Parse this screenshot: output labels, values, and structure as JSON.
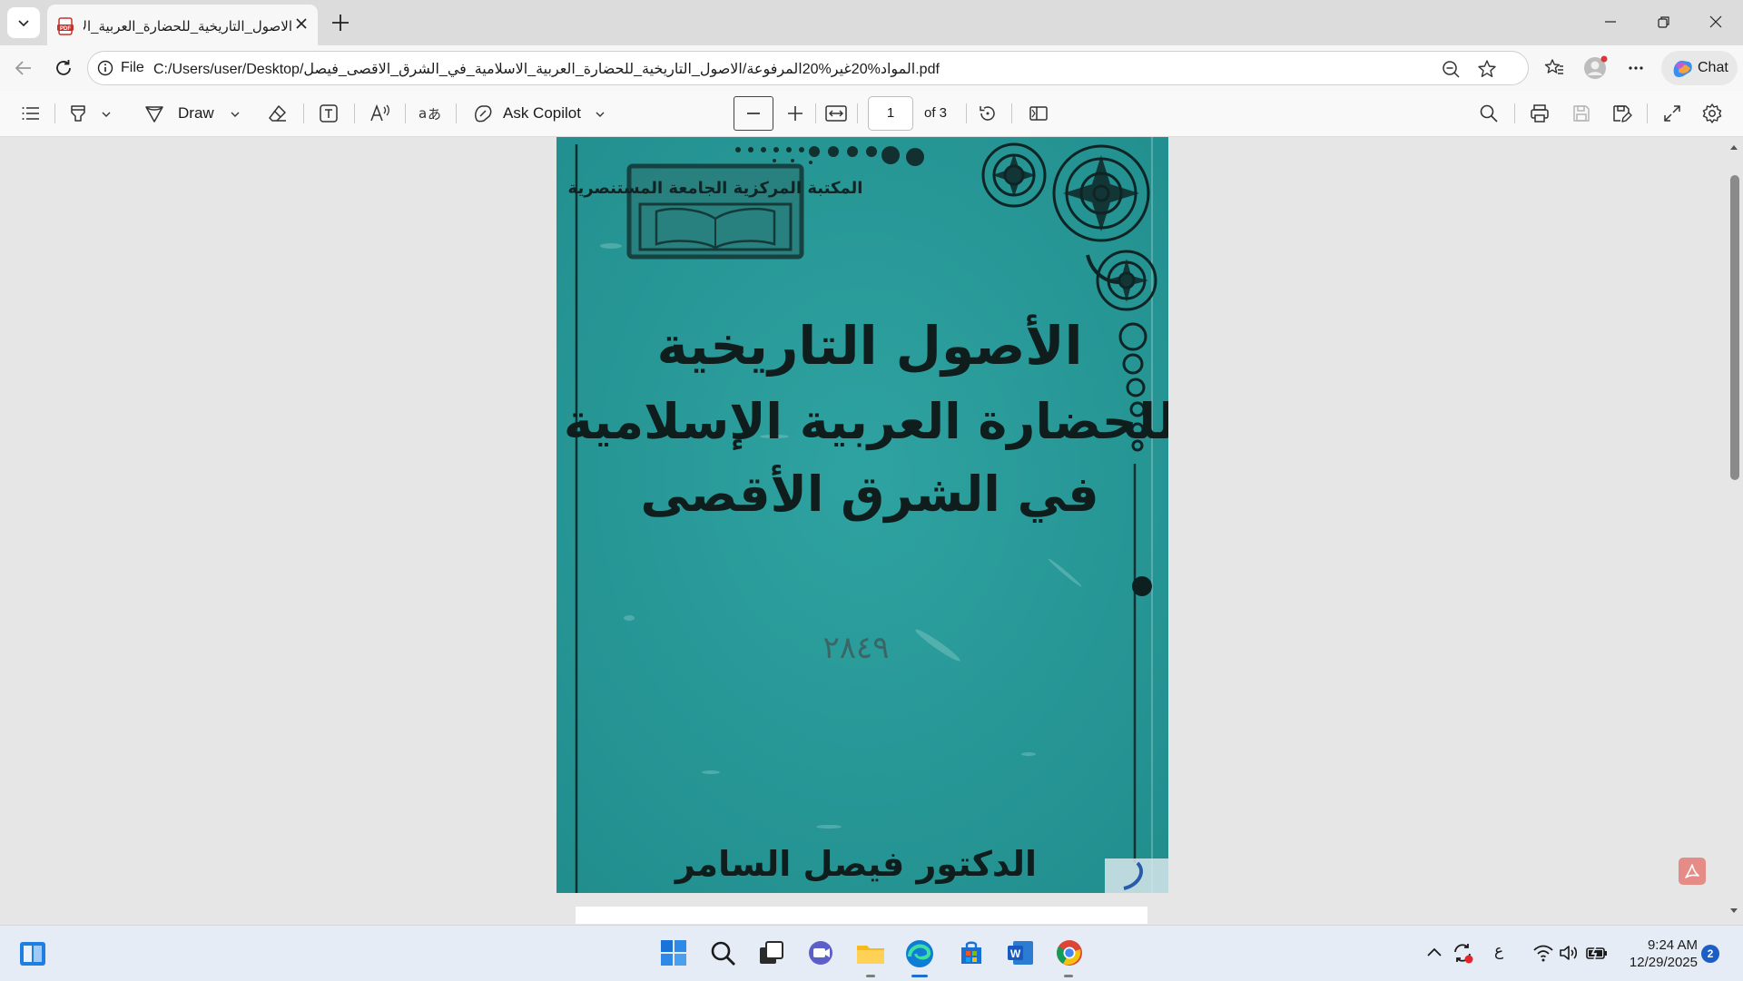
{
  "browser": {
    "tab": {
      "title": "الاصول_التاريخية_للحضارة_العربية_الا"
    },
    "address": {
      "scheme_label": "File",
      "url": "C:/Users/user/Desktop/المواد%20غير%20المرفوعة/الاصول_التاريخية_للحضارة_العربية_الاسلامية_في_الشرق_الاقصى_فيصل.pdf"
    },
    "chat_label": "Chat"
  },
  "pdf_toolbar": {
    "draw_label": "Draw",
    "ask_copilot_label": "Ask Copilot",
    "page_current": "1",
    "page_total_label": "of 3"
  },
  "document": {
    "cover": {
      "title_line1": "الأصول التاريخية",
      "title_line2": "للحضارة العربية الإسلامية",
      "title_line3": "في الشرق الأقصى",
      "author": "الدكتور فيصل السامر",
      "stamp_text": "المكتبة المركزية الجامعة المستنصرية",
      "handwritten_number": "٢٨٤٩",
      "background_color": "#2a9a99"
    }
  },
  "taskbar": {
    "language_indicator": "ع",
    "time": "9:24 AM",
    "date": "12/29/2025",
    "notification_count": "2",
    "pinned_apps": [
      "start-icon",
      "search-icon",
      "task-view-icon",
      "teams-icon",
      "file-explorer-icon",
      "edge-icon",
      "store-icon",
      "word-icon",
      "chrome-icon"
    ]
  }
}
